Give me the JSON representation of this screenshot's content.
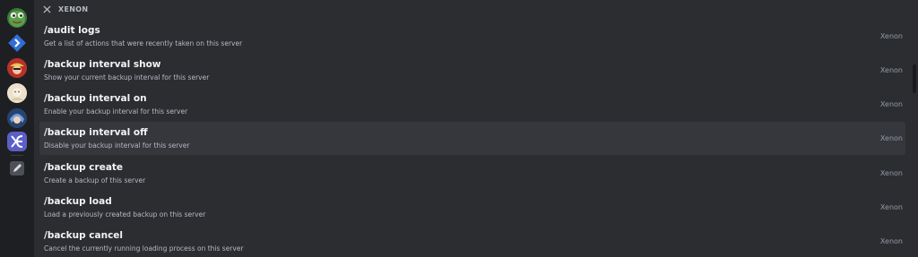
{
  "section": {
    "title": "XENON",
    "icon": "xenon-app-icon"
  },
  "server_rail": [
    {
      "icon": "frog-avatar-icon"
    },
    {
      "icon": "blue-diamond-server-icon"
    },
    {
      "icon": "pirate-avatar-icon"
    },
    {
      "icon": "cream-avatar-icon"
    },
    {
      "icon": "blue-hair-avatar-icon"
    },
    {
      "icon": "xenon-server-icon"
    },
    {
      "icon": "edit-icon"
    }
  ],
  "commands": [
    {
      "name": "/audit logs",
      "description": "Get a list of actions that were recently taken on this server",
      "app": "Xenon"
    },
    {
      "name": "/backup interval show",
      "description": "Show your current backup interval for this server",
      "app": "Xenon"
    },
    {
      "name": "/backup interval on",
      "description": "Enable your backup interval for this server",
      "app": "Xenon"
    },
    {
      "name": "/backup interval off",
      "description": "Disable your backup interval for this server",
      "app": "Xenon"
    },
    {
      "name": "/backup create",
      "description": "Create a backup of this server",
      "app": "Xenon"
    },
    {
      "name": "/backup load",
      "description": "Load a previously created backup on this server",
      "app": "Xenon"
    },
    {
      "name": "/backup cancel",
      "description": "Cancel the currently running loading process on this server",
      "app": "Xenon"
    }
  ],
  "colors": {
    "background": "#2b2d31",
    "rail": "#1e1f22",
    "row_hover": "#35373c",
    "xenon_brand": "#5b5fc7"
  }
}
